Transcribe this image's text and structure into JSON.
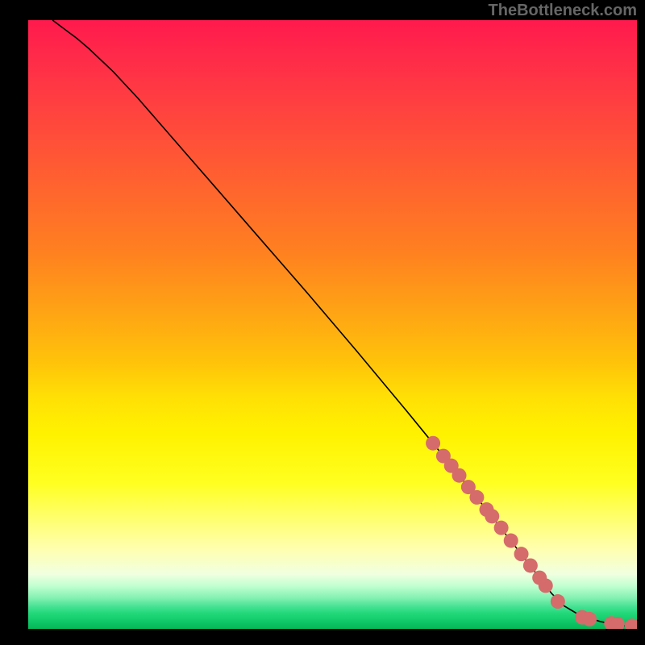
{
  "watermark": "TheBottleneck.com",
  "chart_data": {
    "type": "line",
    "title": "",
    "xlabel": "",
    "ylabel": "",
    "xlim": [
      0,
      100
    ],
    "ylim": [
      0,
      100
    ],
    "curve": {
      "name": "bottleneck-curve",
      "x": [
        4,
        6,
        8,
        10,
        14,
        18,
        22,
        26,
        30,
        34,
        38,
        42,
        46,
        50,
        54,
        58,
        62,
        66,
        70,
        74,
        78,
        82,
        86,
        88,
        90,
        92,
        94,
        96,
        98,
        100
      ],
      "y": [
        100,
        98.5,
        97,
        95.3,
        91.5,
        87.2,
        82.6,
        78.0,
        73.4,
        68.8,
        64.2,
        59.6,
        55.0,
        50.3,
        45.6,
        40.8,
        36.0,
        31.1,
        26.2,
        21.2,
        16.1,
        11.0,
        5.8,
        3.8,
        2.6,
        1.8,
        1.2,
        0.8,
        0.5,
        0.4
      ]
    },
    "points": {
      "name": "highlighted-points",
      "x": [
        66.5,
        68.2,
        69.5,
        70.8,
        72.3,
        73.7,
        75.3,
        76.2,
        77.7,
        79.3,
        81.0,
        82.5,
        84.0,
        85.0,
        87.0,
        91.0,
        92.2,
        95.8,
        96.8,
        99.2,
        100.0
      ],
      "y": [
        30.5,
        28.4,
        26.8,
        25.2,
        23.3,
        21.6,
        19.6,
        18.5,
        16.6,
        14.5,
        12.3,
        10.4,
        8.4,
        7.1,
        4.5,
        1.9,
        1.6,
        0.9,
        0.8,
        0.5,
        0.4
      ]
    }
  }
}
